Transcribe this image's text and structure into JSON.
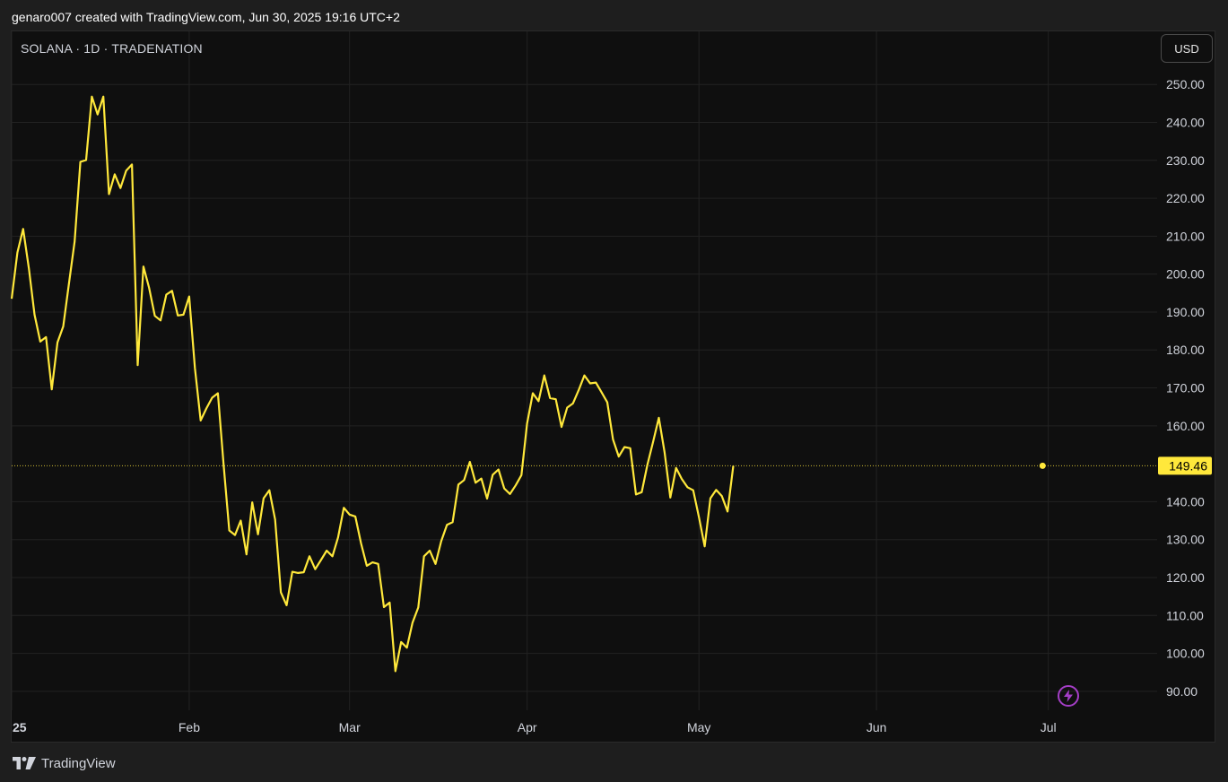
{
  "header": {
    "attribution": "genaro007 created with TradingView.com, Jun 30, 2025 19:16 UTC+2"
  },
  "symbol": {
    "label": "SOLANA · 1D · TRADENATION"
  },
  "currency": {
    "label": "USD"
  },
  "footer": {
    "brand": "TradingView"
  },
  "colors": {
    "line": "#ffe83b",
    "price_tag_bg": "#ffe83b",
    "background": "#0f0f0f",
    "grid": "#222222",
    "bolt": "#a43ec6"
  },
  "icons": {
    "bolt": "lightning-icon",
    "logo": "tradingview-logo-icon"
  },
  "chart_data": {
    "type": "line",
    "title": "",
    "xlabel": "",
    "ylabel": "",
    "ylim": [
      85,
      264
    ],
    "y_ticks": [
      250,
      240,
      230,
      220,
      210,
      200,
      190,
      180,
      170,
      160,
      140,
      130,
      120,
      110,
      100,
      90
    ],
    "y_tick_labels": [
      "250.00",
      "240.00",
      "230.00",
      "220.00",
      "210.00",
      "200.00",
      "190.00",
      "180.00",
      "170.00",
      "160.00",
      "140.00",
      "130.00",
      "120.00",
      "110.00",
      "100.00",
      "90.00"
    ],
    "x_ticks": [
      {
        "label": "25",
        "date": "2025-01-01"
      },
      {
        "label": "Feb",
        "date": "2025-02-01"
      },
      {
        "label": "Mar",
        "date": "2025-03-01"
      },
      {
        "label": "Apr",
        "date": "2025-04-01"
      },
      {
        "label": "May",
        "date": "2025-05-01"
      },
      {
        "label": "Jun",
        "date": "2025-06-01"
      },
      {
        "label": "Jul",
        "date": "2025-07-01"
      }
    ],
    "x_range": [
      "2025-01-01",
      "2025-07-20"
    ],
    "last_price": {
      "value": 149.46,
      "label": "149.46",
      "date": "2025-06-30"
    },
    "grid": true,
    "series": [
      {
        "values": [
          [
            "2025-01-01",
            193.5
          ],
          [
            "2025-01-02",
            205.7
          ],
          [
            "2025-01-03",
            211.9
          ],
          [
            "2025-01-04",
            201.5
          ],
          [
            "2025-01-05",
            189.3
          ],
          [
            "2025-01-06",
            182.2
          ],
          [
            "2025-01-07",
            183.4
          ],
          [
            "2025-01-08",
            169.6
          ],
          [
            "2025-01-09",
            182.0
          ],
          [
            "2025-01-10",
            186.2
          ],
          [
            "2025-01-11",
            197.4
          ],
          [
            "2025-01-12",
            208.6
          ],
          [
            "2025-01-13",
            229.6
          ],
          [
            "2025-01-14",
            230.1
          ],
          [
            "2025-01-15",
            246.8
          ],
          [
            "2025-01-16",
            242.1
          ],
          [
            "2025-01-17",
            246.8
          ],
          [
            "2025-01-18",
            221.1
          ],
          [
            "2025-01-19",
            226.3
          ],
          [
            "2025-01-20",
            222.7
          ],
          [
            "2025-01-21",
            227.3
          ],
          [
            "2025-01-22",
            228.9
          ],
          [
            "2025-01-23",
            176.0
          ],
          [
            "2025-01-24",
            202.0
          ],
          [
            "2025-01-25",
            196.4
          ],
          [
            "2025-01-26",
            189.0
          ],
          [
            "2025-01-27",
            187.8
          ],
          [
            "2025-01-28",
            194.6
          ],
          [
            "2025-01-29",
            195.6
          ],
          [
            "2025-01-30",
            189.1
          ],
          [
            "2025-01-31",
            189.3
          ],
          [
            "2025-02-01",
            194.1
          ],
          [
            "2025-02-02",
            175.2
          ],
          [
            "2025-02-03",
            161.4
          ],
          [
            "2025-02-04",
            164.6
          ],
          [
            "2025-02-05",
            167.4
          ],
          [
            "2025-02-06",
            168.6
          ],
          [
            "2025-02-07",
            150.0
          ],
          [
            "2025-02-08",
            132.4
          ],
          [
            "2025-02-09",
            131.2
          ],
          [
            "2025-02-10",
            135.0
          ],
          [
            "2025-02-11",
            126.1
          ],
          [
            "2025-02-12",
            139.8
          ],
          [
            "2025-02-13",
            131.4
          ],
          [
            "2025-02-14",
            140.9
          ],
          [
            "2025-02-15",
            143.0
          ],
          [
            "2025-02-16",
            135.3
          ],
          [
            "2025-02-17",
            116.1
          ],
          [
            "2025-02-18",
            112.7
          ],
          [
            "2025-02-19",
            121.5
          ],
          [
            "2025-02-20",
            121.2
          ],
          [
            "2025-02-21",
            121.4
          ],
          [
            "2025-02-22",
            125.6
          ],
          [
            "2025-02-23",
            122.2
          ],
          [
            "2025-02-24",
            124.6
          ],
          [
            "2025-02-25",
            127.1
          ],
          [
            "2025-02-26",
            125.6
          ],
          [
            "2025-02-27",
            130.6
          ],
          [
            "2025-02-28",
            138.4
          ],
          [
            "2025-03-01",
            136.6
          ],
          [
            "2025-03-02",
            136.1
          ],
          [
            "2025-03-03",
            129.0
          ],
          [
            "2025-03-04",
            123.1
          ],
          [
            "2025-03-05",
            124.0
          ],
          [
            "2025-03-06",
            123.6
          ],
          [
            "2025-03-07",
            112.2
          ],
          [
            "2025-03-08",
            113.4
          ],
          [
            "2025-03-09",
            95.3
          ],
          [
            "2025-03-10",
            103.0
          ],
          [
            "2025-03-11",
            101.5
          ],
          [
            "2025-03-12",
            108.1
          ],
          [
            "2025-03-13",
            112.1
          ],
          [
            "2025-03-14",
            125.6
          ],
          [
            "2025-03-15",
            127.1
          ],
          [
            "2025-03-16",
            123.6
          ],
          [
            "2025-03-17",
            129.6
          ],
          [
            "2025-03-18",
            133.9
          ],
          [
            "2025-03-19",
            134.6
          ],
          [
            "2025-03-20",
            144.5
          ],
          [
            "2025-03-21",
            145.7
          ],
          [
            "2025-03-22",
            150.5
          ],
          [
            "2025-03-23",
            145.0
          ],
          [
            "2025-03-24",
            146.1
          ],
          [
            "2025-03-25",
            140.8
          ],
          [
            "2025-03-26",
            147.1
          ],
          [
            "2025-03-27",
            148.5
          ],
          [
            "2025-03-28",
            143.5
          ],
          [
            "2025-03-29",
            142.0
          ],
          [
            "2025-03-30",
            144.3
          ],
          [
            "2025-03-31",
            147.0
          ],
          [
            "2025-04-01",
            160.6
          ],
          [
            "2025-04-02",
            168.6
          ],
          [
            "2025-04-03",
            166.5
          ],
          [
            "2025-04-04",
            173.3
          ],
          [
            "2025-04-05",
            167.3
          ],
          [
            "2025-04-06",
            167.0
          ],
          [
            "2025-04-07",
            159.7
          ],
          [
            "2025-04-08",
            164.8
          ],
          [
            "2025-04-09",
            165.9
          ],
          [
            "2025-04-10",
            169.4
          ],
          [
            "2025-04-11",
            173.3
          ],
          [
            "2025-04-12",
            171.2
          ],
          [
            "2025-04-13",
            171.4
          ],
          [
            "2025-04-14",
            168.8
          ],
          [
            "2025-04-15",
            166.2
          ],
          [
            "2025-04-16",
            156.4
          ],
          [
            "2025-04-17",
            151.9
          ],
          [
            "2025-04-18",
            154.4
          ],
          [
            "2025-04-19",
            154.1
          ],
          [
            "2025-04-20",
            141.9
          ],
          [
            "2025-04-21",
            142.5
          ],
          [
            "2025-04-22",
            149.7
          ],
          [
            "2025-04-23",
            155.8
          ],
          [
            "2025-04-24",
            162.1
          ],
          [
            "2025-04-25",
            153.0
          ],
          [
            "2025-04-26",
            141.1
          ],
          [
            "2025-04-27",
            148.9
          ],
          [
            "2025-04-28",
            146.0
          ],
          [
            "2025-04-29",
            143.8
          ],
          [
            "2025-04-30",
            143.0
          ],
          [
            "2025-05-01",
            135.9
          ],
          [
            "2025-05-02",
            128.2
          ],
          [
            "2025-05-03",
            140.9
          ],
          [
            "2025-05-04",
            143.1
          ],
          [
            "2025-05-05",
            141.5
          ],
          [
            "2025-05-06",
            137.4
          ],
          [
            "2025-05-07",
            149.46
          ]
        ]
      }
    ]
  }
}
